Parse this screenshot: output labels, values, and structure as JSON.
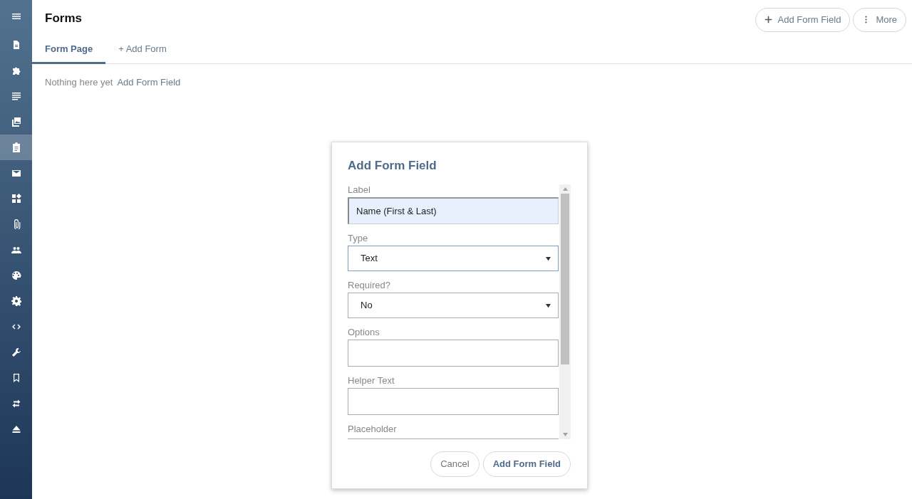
{
  "sidebar": {
    "items": [
      {
        "kind": "menu",
        "selected": false
      },
      {
        "kind": "document",
        "selected": false
      },
      {
        "kind": "puzzle",
        "selected": false
      },
      {
        "kind": "lines",
        "selected": false
      },
      {
        "kind": "images",
        "selected": false
      },
      {
        "kind": "clipboard",
        "selected": true
      },
      {
        "kind": "mail",
        "selected": false
      },
      {
        "kind": "widgets",
        "selected": false
      },
      {
        "kind": "paperclip",
        "selected": false
      },
      {
        "kind": "people",
        "selected": false
      },
      {
        "kind": "palette",
        "selected": false
      },
      {
        "kind": "gear",
        "selected": false
      },
      {
        "kind": "code",
        "selected": false
      },
      {
        "kind": "wrench",
        "selected": false
      },
      {
        "kind": "bookmark",
        "selected": false
      },
      {
        "kind": "swap",
        "selected": false
      },
      {
        "kind": "eject",
        "selected": false
      }
    ]
  },
  "header": {
    "title": "Forms",
    "actions": [
      {
        "kind": "plus",
        "label": "Add Form Field"
      },
      {
        "kind": "kebab",
        "label": "More"
      }
    ]
  },
  "tabs": [
    {
      "label": "Form Page",
      "selected": true
    },
    {
      "label": "+ Add Form",
      "selected": false
    }
  ],
  "empty_state": {
    "message": "Nothing here yet",
    "link": "Add Form Field"
  },
  "dialog": {
    "title": "Add Form Field",
    "fields": [
      {
        "label": "Label",
        "kind": "input",
        "value": "Name (First & Last)",
        "highlighted": true,
        "focused": false
      },
      {
        "label": "Type",
        "kind": "select",
        "value": "Text",
        "highlighted": false,
        "focused": true
      },
      {
        "label": "Required?",
        "kind": "select",
        "value": "No",
        "highlighted": false,
        "focused": false
      },
      {
        "label": "Options",
        "kind": "input",
        "highlighted": false,
        "focused": false
      },
      {
        "label": "Helper Text",
        "kind": "input",
        "highlighted": false,
        "focused": false
      },
      {
        "label": "Placeholder",
        "kind": "cut",
        "highlighted": false,
        "focused": false
      }
    ],
    "buttons": [
      {
        "label": "Cancel",
        "primary": false
      },
      {
        "label": "Add Form Field",
        "primary": true
      }
    ]
  }
}
